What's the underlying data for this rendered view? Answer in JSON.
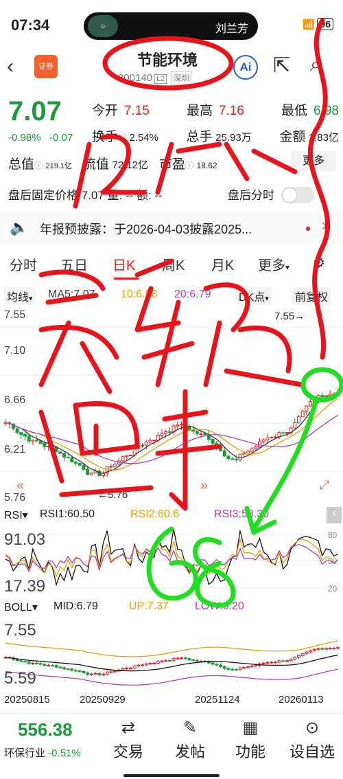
{
  "status": {
    "time": "07:34",
    "contact": "刘兰芳",
    "battery": "96"
  },
  "header": {
    "title": "节能环境",
    "code": "300140",
    "l2": "L2",
    "exchange": "深圳",
    "badge": "证券",
    "ai_label": "Ai"
  },
  "quote": {
    "price": "7.07",
    "change_pct": "-0.98%",
    "change": "-0.07",
    "open_label": "今开",
    "open": "7.15",
    "high_label": "最高",
    "high": "7.16",
    "low_label": "最低",
    "low": "6.98",
    "turnover_label": "换手",
    "turnover": "2.54%",
    "volume_label": "总手",
    "volume": "25.93万",
    "amount_label": "金额",
    "amount": "1.83亿",
    "mktcap_label": "总值",
    "mktcap": "219.1亿",
    "float_label": "流值",
    "float": "72.12亿",
    "pe_label": "市盈",
    "pe": "18.62",
    "more": "更多"
  },
  "after_hours": {
    "text": "盘后固定价格 7.07 量: -- 额: --",
    "time_label": "盘后分时"
  },
  "notice": {
    "text": "年报预披露：于2026-04-03披露2025..."
  },
  "tabs": [
    "分时",
    "五日",
    "日K",
    "周K",
    "月K",
    "更多"
  ],
  "indicators": {
    "ma_label": "均线",
    "ma5": "MA5:7.07",
    "ma10": "10:6.98",
    "ma20": "20:6.79",
    "dk": "DK点",
    "adj": "前复权"
  },
  "kline": {
    "y_labels": [
      "7.55",
      "7.10",
      "6.66",
      "6.21",
      "5.76"
    ],
    "hi_mark": "7.55",
    "lo_mark": "5.76"
  },
  "rsi": {
    "label": "RSI",
    "rsi1": "RSI1:60.50",
    "rsi2": "RSI2:60.6",
    "rsi3": "RSI3:58.30",
    "y_hi": "91.03",
    "y_lo": "17.39",
    "r80": "80",
    "r50": "50",
    "r20": "20"
  },
  "boll": {
    "label": "BOLL",
    "mid": "MID:6.79",
    "up": "UP:7.37",
    "low": "LOW:6.20",
    "y_hi": "7.55",
    "y_lo": "5.59"
  },
  "dates": [
    "20250815",
    "20250929",
    "20251124",
    "20260113"
  ],
  "bottom": {
    "index_value": "556.38",
    "index_name": "环保行业",
    "index_change": "-0.51%",
    "nav": [
      "交易",
      "发帖",
      "功能",
      "设自选"
    ]
  },
  "colors": {
    "up": "#e02020",
    "down": "#1a9a3a",
    "scribble_red": "#e8141c",
    "scribble_green": "#22dd22"
  }
}
